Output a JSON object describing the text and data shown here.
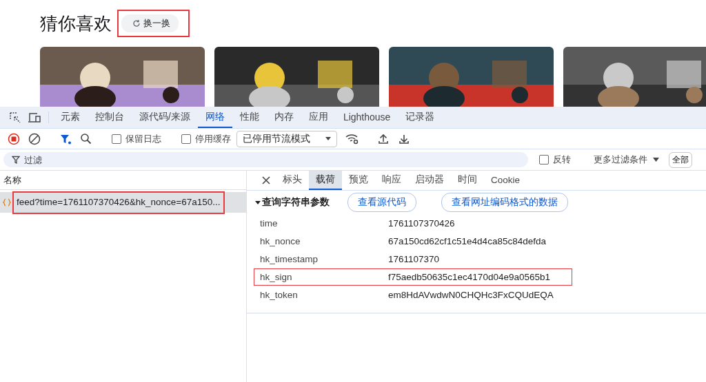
{
  "page": {
    "heading": "猜你喜欢",
    "swap_button": {
      "label": "换一换",
      "highlighted": true
    }
  },
  "devtools": {
    "panel_tabs": [
      {
        "label": "元素",
        "selected": false
      },
      {
        "label": "控制台",
        "selected": false
      },
      {
        "label": "源代码/来源",
        "selected": false
      },
      {
        "label": "网络",
        "selected": true
      },
      {
        "label": "性能",
        "selected": false
      },
      {
        "label": "内存",
        "selected": false
      },
      {
        "label": "应用",
        "selected": false
      },
      {
        "label": "Lighthouse",
        "selected": false
      },
      {
        "label": "记录器",
        "selected": false
      }
    ],
    "toolbar": {
      "recording": true,
      "filter_active": true,
      "preserve_log": {
        "label": "保留日志",
        "checked": false
      },
      "disable_cache": {
        "label": "停用缓存",
        "checked": false
      },
      "throttle": "已停用节流模式"
    },
    "filter": {
      "placeholder": "过滤",
      "invert": {
        "label": "反转",
        "checked": false
      },
      "more_filters": "更多过滤条件",
      "all_button": "全部"
    },
    "requests": {
      "column": "名称",
      "rows": [
        {
          "name": "feed?time=1761107370426&hk_nonce=67a150...",
          "selected": true,
          "highlighted": true
        }
      ]
    },
    "detail": {
      "tabs": [
        {
          "label": "标头",
          "selected": false
        },
        {
          "label": "载荷",
          "selected": true
        },
        {
          "label": "预览",
          "selected": false
        },
        {
          "label": "响应",
          "selected": false
        },
        {
          "label": "启动器",
          "selected": false
        },
        {
          "label": "时间",
          "selected": false
        },
        {
          "label": "Cookie",
          "selected": false
        }
      ],
      "section": {
        "title": "查询字符串参数",
        "expanded": true,
        "buttons": [
          "查看源代码",
          "查看网址编码格式的数据"
        ],
        "params": [
          {
            "name": "time",
            "value": "1761107370426",
            "highlighted": false
          },
          {
            "name": "hk_nonce",
            "value": "67a150cd62cf1c51e4d4ca85c84defda",
            "highlighted": false
          },
          {
            "name": "hk_timestamp",
            "value": "1761107370",
            "highlighted": false
          },
          {
            "name": "hk_sign",
            "value": "f75aedb50635c1ec4170d04e9a0565b1",
            "highlighted": true
          },
          {
            "name": "hk_token",
            "value": "em8HdAVwdwN0CHQHc3FxCQUdEQA",
            "highlighted": false
          }
        ]
      }
    }
  }
}
